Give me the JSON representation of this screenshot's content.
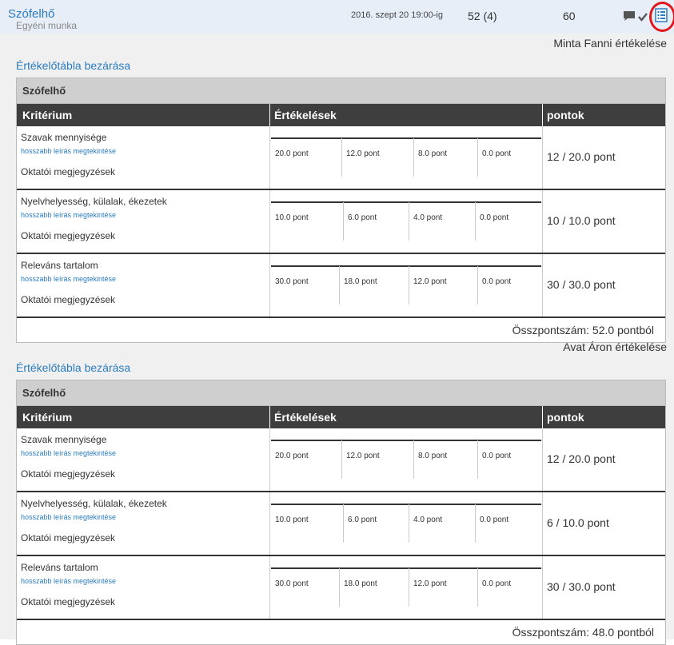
{
  "assignment": {
    "title": "Szófelhő",
    "subtitle": "Egyéni munka",
    "deadline": "2016. szept 20 19:00-ig",
    "score": "52 (4)",
    "max": "60",
    "icons": [
      "comment-icon",
      "check-icon",
      "rubric-icon"
    ],
    "highlight_color": "#e0161d"
  },
  "evaluations": [
    {
      "evaluator": "Minta Fanni értékelése",
      "close_label": "Értékelőtábla bezárása",
      "rubric_title": "Szófelhő",
      "headers": [
        "Kritérium",
        "Értékelések",
        "pontok"
      ],
      "criteria": [
        {
          "name": "Szavak mennyisége",
          "more": "hosszabb leírás megtekintése",
          "note": "Oktatói megjegyzések",
          "ratings": [
            "20.0 pont",
            "12.0 pont",
            "8.0 pont",
            "0.0 pont"
          ],
          "points": "12 / 20.0 pont"
        },
        {
          "name": "Nyelvhelyesség, külalak, ékezetek",
          "more": "hosszabb leírás megtekintése",
          "note": "Oktatói megjegyzések",
          "ratings": [
            "10.0 pont",
            "6.0 pont",
            "4.0 pont",
            "0.0 pont"
          ],
          "points": "10 / 10.0 pont"
        },
        {
          "name": "Releváns tartalom",
          "more": "hosszabb leírás megtekintése",
          "note": "Oktatói megjegyzések",
          "ratings": [
            "30.0 pont",
            "18.0 pont",
            "12.0 pont",
            "0.0 pont"
          ],
          "points": "30 / 30.0 pont"
        }
      ],
      "total": "Összpontszám: 52.0 pontból"
    },
    {
      "evaluator": "Avat Áron értékelése",
      "close_label": "Értékelőtábla bezárása",
      "rubric_title": "Szófelhő",
      "headers": [
        "Kritérium",
        "Értékelések",
        "pontok"
      ],
      "criteria": [
        {
          "name": "Szavak mennyisége",
          "more": "hosszabb leírás megtekintése",
          "note": "Oktatói megjegyzések",
          "ratings": [
            "20.0 pont",
            "12.0 pont",
            "8.0 pont",
            "0.0 pont"
          ],
          "points": "12 / 20.0 pont"
        },
        {
          "name": "Nyelvhelyesség, külalak, ékezetek",
          "more": "hosszabb leírás megtekintése",
          "note": "Oktatói megjegyzések",
          "ratings": [
            "10.0 pont",
            "6.0 pont",
            "4.0 pont",
            "0.0 pont"
          ],
          "points": "6 / 10.0 pont"
        },
        {
          "name": "Releváns tartalom",
          "more": "hosszabb leírás megtekintése",
          "note": "Oktatói megjegyzések",
          "ratings": [
            "30.0 pont",
            "18.0 pont",
            "12.0 pont",
            "0.0 pont"
          ],
          "points": "30 / 30.0 pont"
        }
      ],
      "total": "Összpontszám: 48.0 pontból"
    }
  ]
}
